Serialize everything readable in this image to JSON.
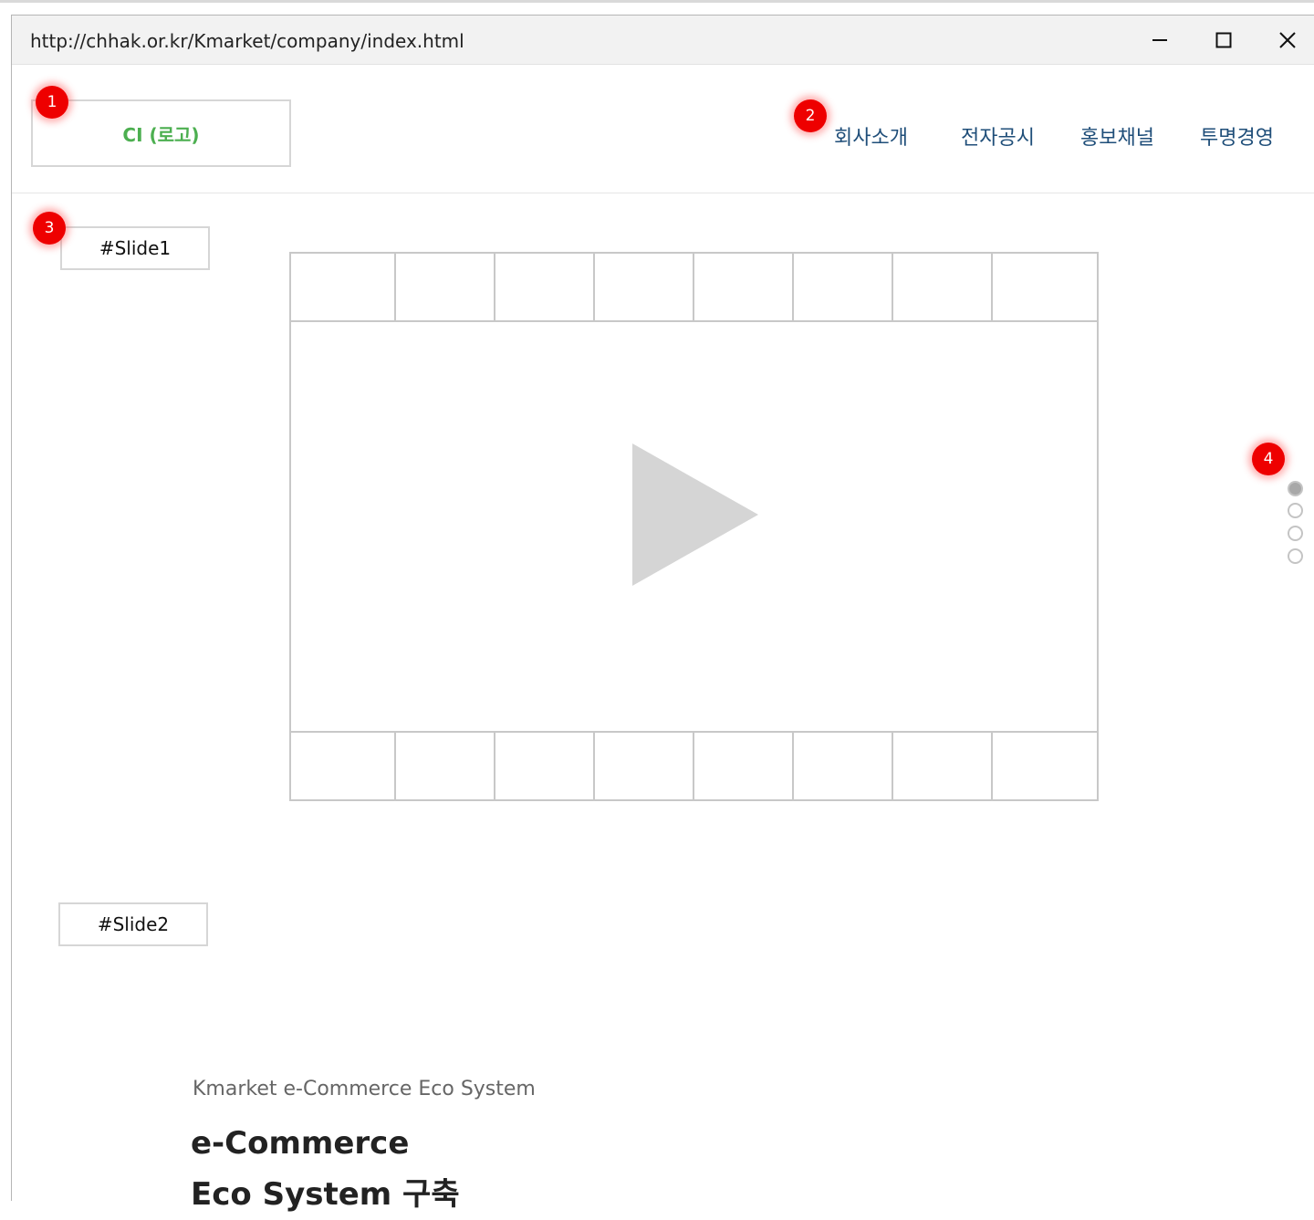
{
  "window": {
    "url": "http://chhak.or.kr/Kmarket/company/index.html",
    "controls": [
      "minimize",
      "maximize",
      "close"
    ]
  },
  "header": {
    "logo_text": "CI (로고)",
    "nav": [
      {
        "label": "회사소개"
      },
      {
        "label": "전자공시"
      },
      {
        "label": "홍보채널"
      },
      {
        "label": "투명경영"
      }
    ]
  },
  "badges": [
    "1",
    "2",
    "3",
    "4"
  ],
  "slides": {
    "slide1_label": "#Slide1",
    "slide2_label": "#Slide2"
  },
  "pager": {
    "count": 4,
    "active_index": 0
  },
  "section": {
    "subtitle": "Kmarket e-Commerce Eco System",
    "title_line1": "e-Commerce",
    "title_line2": "Eco System 구축"
  },
  "colors": {
    "logo_text": "#4caf50",
    "nav_text": "#1f4e79",
    "badge": "#ee0000",
    "placeholder_stroke": "#c8c8c8",
    "play_icon": "#d5d5d5"
  },
  "icons": {
    "video": "play-icon",
    "minimize": "minimize-icon",
    "maximize": "maximize-icon",
    "close": "close-icon"
  }
}
